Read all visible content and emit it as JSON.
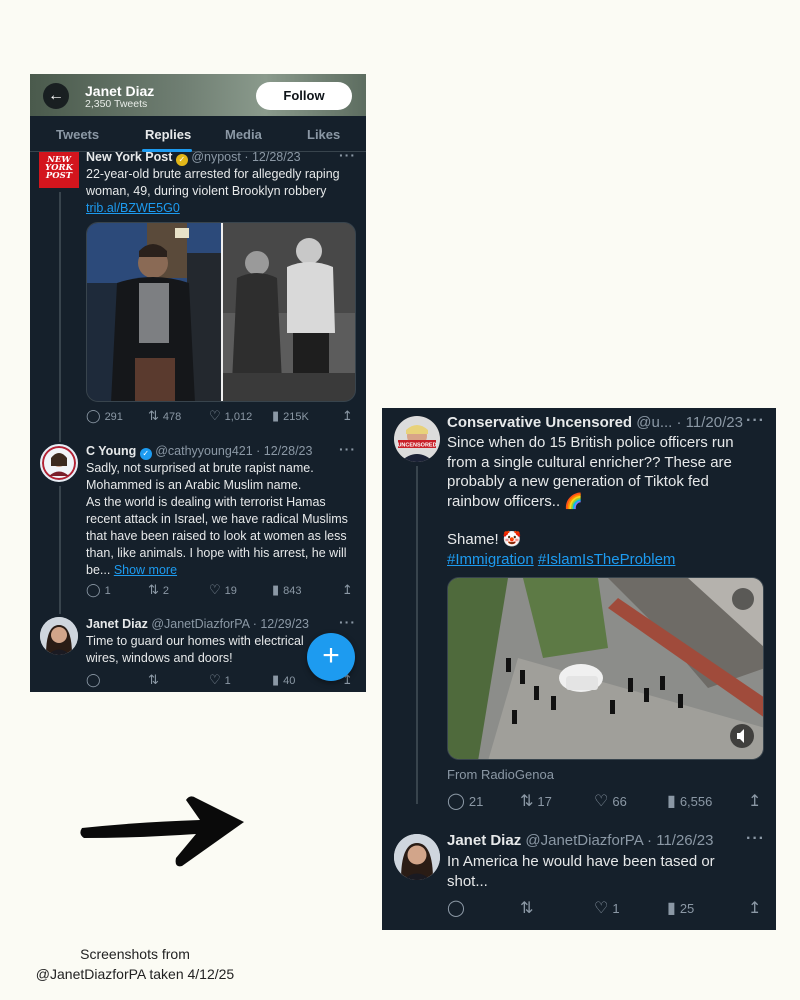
{
  "left_screenshot": {
    "profile": {
      "name": "Janet Diaz",
      "tweet_count": "2,350 Tweets",
      "follow_label": "Follow"
    },
    "tabs": [
      {
        "label": "Tweets"
      },
      {
        "label": "Replies"
      },
      {
        "label": "Media"
      },
      {
        "label": "Likes"
      }
    ],
    "tweets": [
      {
        "author": "New York Post",
        "meta": "@nypost · 12/28/23",
        "logo_lines": [
          "NEW",
          "YORK",
          "POST"
        ],
        "text": "22-year-old brute arrested for allegedly raping woman, 49, during violent Brooklyn robbery",
        "link": "trib.al/BZWE5G0",
        "replies": "291",
        "retweets": "478",
        "likes": "1,012",
        "views": "215K"
      },
      {
        "author": "C Young",
        "meta": "@cathyyoung421 · 12/28/23",
        "text": "Sadly, not surprised at brute rapist name. Mohammed is an Arabic Muslim name.\nAs the world is dealing with terrorist Hamas recent attack in Israel, we have radical Muslims that have been raised to look at women as less than, like animals. I hope with his arrest, he will be...",
        "show_more": "Show more",
        "replies": "1",
        "retweets": "2",
        "likes": "19",
        "views": "843"
      },
      {
        "author": "Janet Diaz",
        "meta": "@JanetDiazforPA · 12/29/23",
        "text": "Time to guard our homes with electrical wires, windows and doors!",
        "replies": "",
        "retweets": "",
        "likes": "1",
        "views": "40"
      }
    ],
    "fab_label": "+"
  },
  "right_screenshot": {
    "tweets": [
      {
        "author": "Conservative Uncensored",
        "meta": "@u... · 11/20/23",
        "avatar_label": "UNCENSORED",
        "text": "Since when do 15 British police officers run from a single cultural enricher?? These are probably a new generation of Tiktok fed rainbow officers.. 🌈",
        "text2": "Shame! 🤡",
        "hashtags": [
          "#Immigration",
          "#IslamIsTheProblem"
        ],
        "source": "From RadioGenoa",
        "replies": "21",
        "retweets": "17",
        "likes": "66",
        "views": "6,556"
      },
      {
        "author": "Janet Diaz",
        "meta": "@JanetDiazforPA · 11/26/23",
        "text": "In America he would have been tased or shot...",
        "replies": "",
        "retweets": "",
        "likes": "1",
        "views": "25"
      }
    ]
  },
  "caption": {
    "line1": "Screenshots from",
    "line2": "@JanetDiazforPA taken 4/12/25"
  },
  "colors": {
    "page": "#fbfbf4",
    "twitter_bg": "#15202b",
    "accent": "#1d9bf0",
    "muted": "#8b98a5",
    "nyp_red": "#d3151d"
  }
}
